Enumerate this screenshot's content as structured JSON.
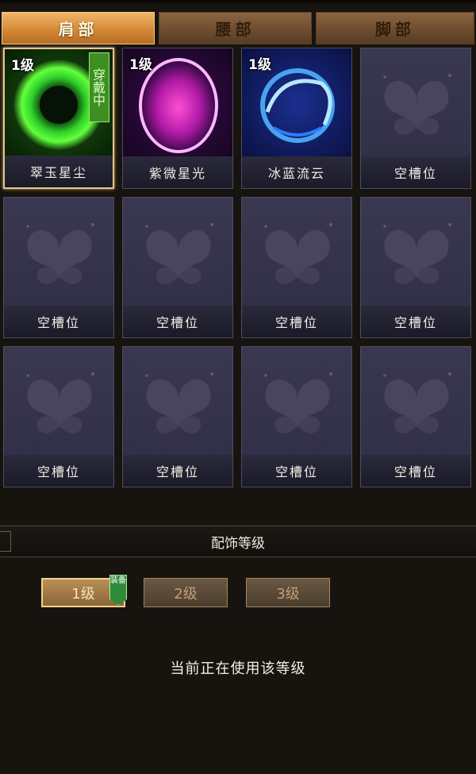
{
  "tabs": [
    {
      "label": "肩部",
      "active": true
    },
    {
      "label": "腰部",
      "active": false
    },
    {
      "label": "脚部",
      "active": false
    }
  ],
  "slots": [
    {
      "name": "翠玉星尘",
      "level": "1级",
      "wear_tag": "穿戴中",
      "art": "green-starburst-orb",
      "selected": true
    },
    {
      "name": "紫微星光",
      "level": "1级",
      "art": "purple-halo-orb"
    },
    {
      "name": "冰蓝流云",
      "level": "1级",
      "art": "blue-swirl-orb"
    },
    {
      "name": "空槽位",
      "art": "butterfly-placeholder"
    },
    {
      "name": "空槽位",
      "art": "butterfly-placeholder"
    },
    {
      "name": "空槽位",
      "art": "butterfly-placeholder"
    },
    {
      "name": "空槽位",
      "art": "butterfly-placeholder"
    },
    {
      "name": "空槽位",
      "art": "butterfly-placeholder"
    },
    {
      "name": "空槽位",
      "art": "butterfly-placeholder"
    },
    {
      "name": "空槽位",
      "art": "butterfly-placeholder"
    },
    {
      "name": "空槽位",
      "art": "butterfly-placeholder"
    },
    {
      "name": "空槽位",
      "art": "butterfly-placeholder"
    }
  ],
  "level_section": {
    "title": "配饰等级",
    "buttons": [
      {
        "label": "1级",
        "active": true
      },
      {
        "label": "2级",
        "active": false
      },
      {
        "label": "3级",
        "active": false
      }
    ],
    "equip_badge": "装备",
    "status": "当前正在使用该等级"
  },
  "colors": {
    "accent_gold": "#f3d28e",
    "tab_active": "#d48a38",
    "wear_green": "#3e8f22",
    "slot_bg": "#34334a"
  }
}
